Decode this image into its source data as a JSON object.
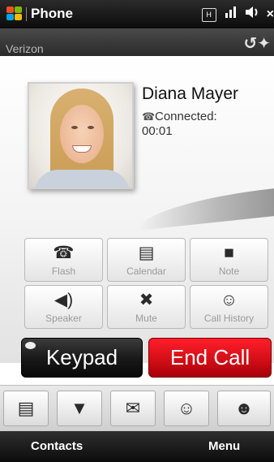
{
  "status_bar": {
    "app_title": "Phone",
    "icons": [
      "windows-logo-icon",
      "network-h-icon",
      "signal-icon",
      "volume-icon",
      "close-icon"
    ],
    "network_label": "H",
    "close_glyph": "×"
  },
  "carrier": {
    "name": "Verizon",
    "icons": [
      "call-active-icon",
      "call-forward-icon"
    ]
  },
  "call": {
    "contact_name": "Diana Mayer",
    "status": "Connected:",
    "duration": "00:01"
  },
  "call_buttons": [
    {
      "label": "Flash",
      "icon": "flash-icon"
    },
    {
      "label": "Calendar",
      "icon": "calendar-icon"
    },
    {
      "label": "Note",
      "icon": "note-icon"
    },
    {
      "label": "Speaker",
      "icon": "speaker-icon"
    },
    {
      "label": "Mute",
      "icon": "mute-icon"
    },
    {
      "label": "Call History",
      "icon": "call-history-icon"
    }
  ],
  "actions": {
    "keypad_label": "Keypad",
    "end_call_label": "End Call"
  },
  "tabs": [
    {
      "icon": "contact-card-icon"
    },
    {
      "icon": "message-icon"
    },
    {
      "icon": "email-icon"
    },
    {
      "icon": "contact-time-icon"
    },
    {
      "icon": "contact-assign-icon"
    }
  ],
  "softkeys": {
    "left": "Contacts",
    "right": "Menu"
  },
  "colors": {
    "end_call": "#d40f17",
    "keypad": "#1a1a1a",
    "status_bar": "#1a1a1a"
  }
}
